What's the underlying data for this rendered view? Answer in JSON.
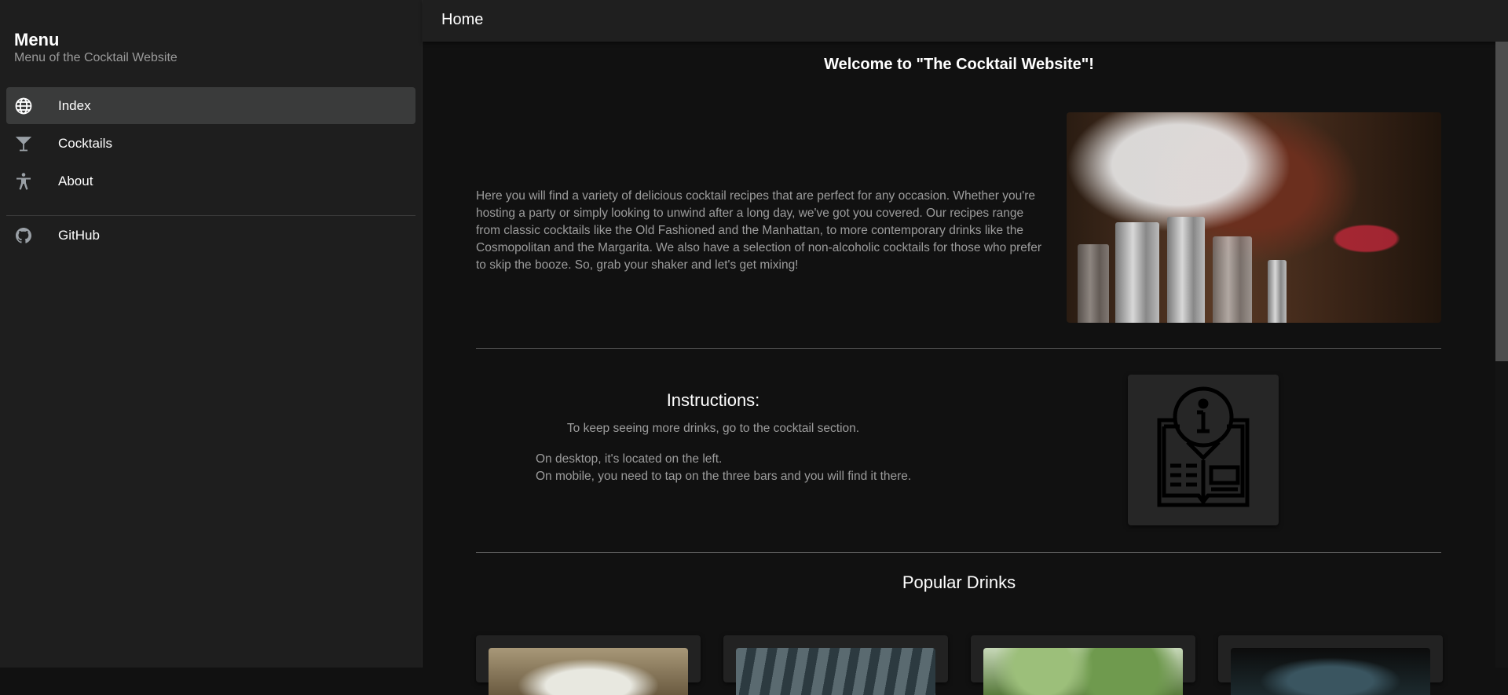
{
  "sidebar": {
    "title": "Menu",
    "subtitle": "Menu of the Cocktail Website",
    "items": [
      {
        "label": "Index",
        "icon": "globe-icon",
        "active": true
      },
      {
        "label": "Cocktails",
        "icon": "martini-glass-icon",
        "active": false
      },
      {
        "label": "About",
        "icon": "accessibility-icon",
        "active": false
      }
    ],
    "links": [
      {
        "label": "GitHub",
        "icon": "github-icon"
      }
    ]
  },
  "topbar": {
    "title": "Home"
  },
  "main": {
    "welcome": "Welcome to \"The Cocktail Website\"!",
    "intro": "Here you will find a variety of delicious cocktail recipes that are perfect for any occasion. Whether you're hosting a party or simply looking to unwind after a long day, we've got you covered. Our recipes range from classic cocktails like the Old Fashioned and the Manhattan, to more contemporary drinks like the Cosmopolitan and the Margarita. We also have a selection of non-alcoholic cocktails for those who prefer to skip the booze. So, grab your shaker and let's get mixing!",
    "instructions": {
      "title": "Instructions:",
      "line1": "To keep seeing more drinks, go to the cocktail section.",
      "line2": "On desktop, it's located on the left.",
      "line3": "On mobile, you need to tap on the three bars and you will find it there."
    },
    "popular_title": "Popular Drinks"
  },
  "colors": {
    "background": "#111111",
    "sidebar": "#1e1e1e",
    "active_item": "#3a3b3b",
    "muted_text": "#9c9c9c"
  }
}
